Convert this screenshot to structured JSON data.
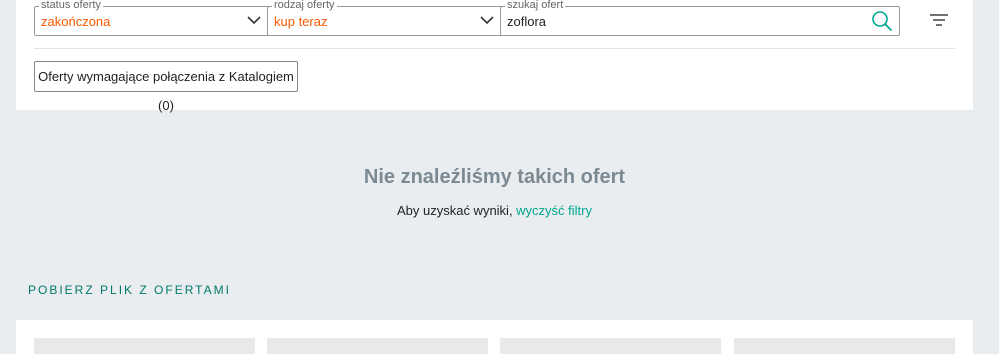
{
  "filters": {
    "status": {
      "label": "status oferty",
      "value": "zakończona"
    },
    "type": {
      "label": "rodzaj oferty",
      "value": "kup teraz"
    },
    "search": {
      "label": "szukaj ofert",
      "value": "zoflora"
    }
  },
  "catalog_button": "Oferty wymagające połączenia z Katalogiem (0)",
  "empty_state": {
    "title": "Nie znaleźliśmy takich ofert",
    "subtitle_prefix": "Aby uzyskać wyniki, ",
    "clear_link": "wyczyść filtry"
  },
  "download_section": {
    "title": "POBIERZ PLIK Z OFERTAMI"
  },
  "colors": {
    "accent": "#00a790",
    "value_highlight": "#ff5a00",
    "background": "#eaedf0"
  },
  "icons": [
    "chevron-down-icon",
    "search-icon",
    "filter-icon"
  ]
}
